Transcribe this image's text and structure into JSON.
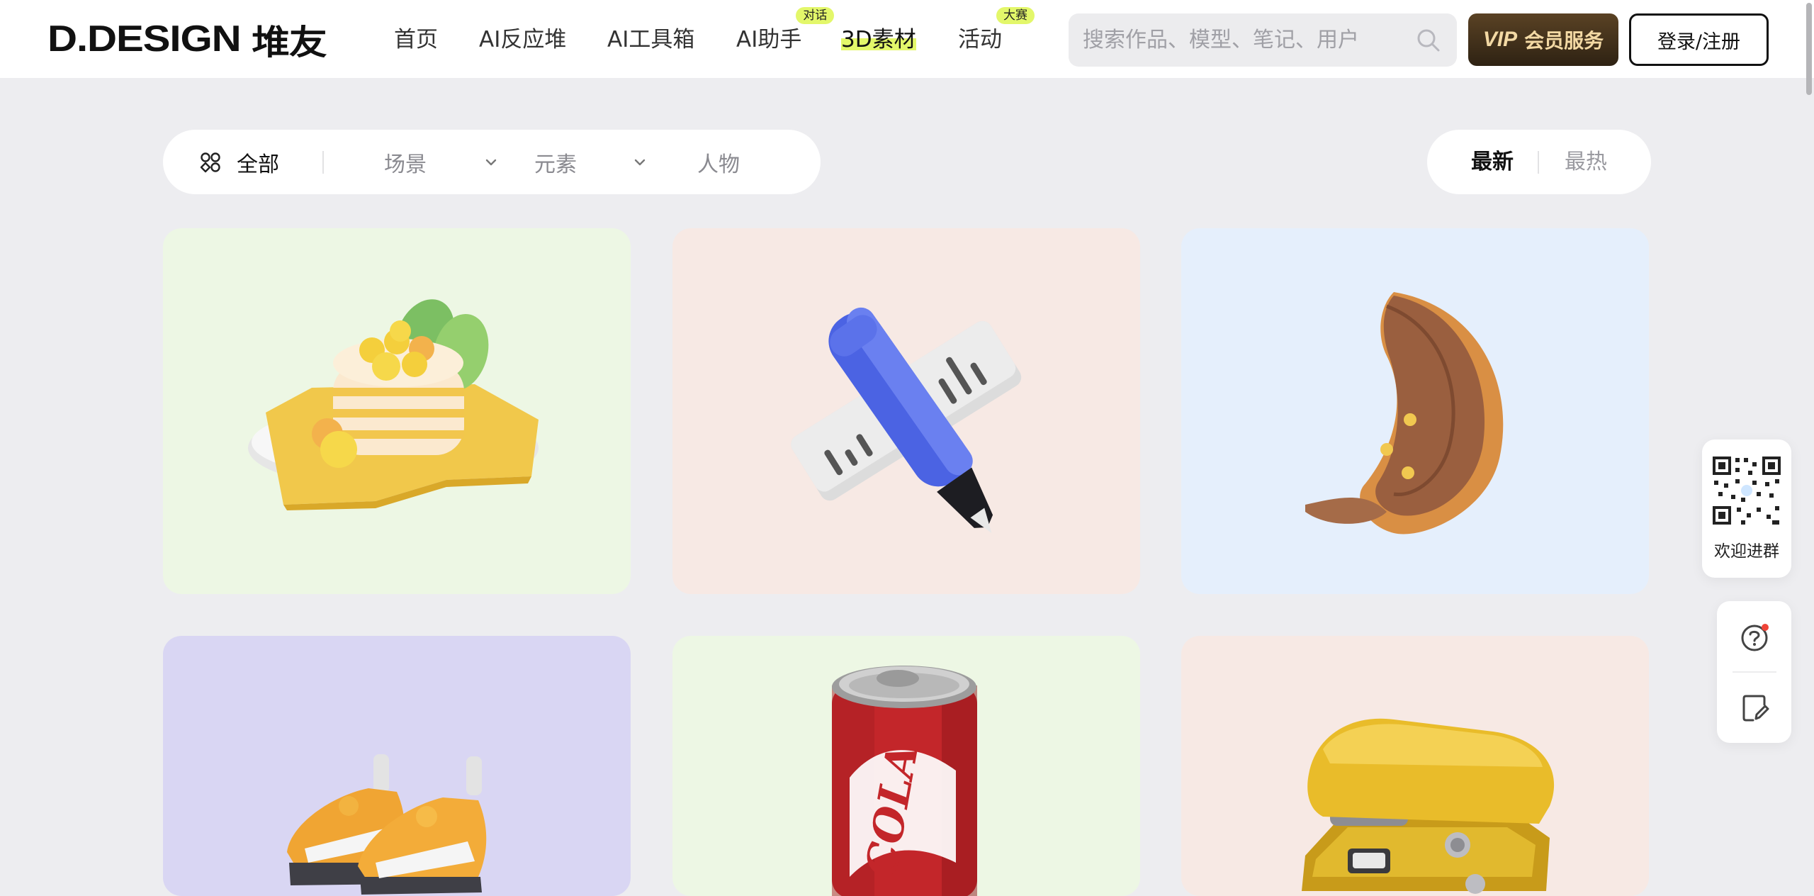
{
  "header": {
    "logo_text": "D.DESIGN",
    "logo_cn": "堆友",
    "nav": [
      {
        "label": "首页",
        "badge": ""
      },
      {
        "label": "AI反应堆",
        "badge": ""
      },
      {
        "label": "AI工具箱",
        "badge": ""
      },
      {
        "label": "AI助手",
        "badge": "对话"
      },
      {
        "label": "3D素材",
        "badge": "",
        "active": true
      },
      {
        "label": "活动",
        "badge": "大赛"
      }
    ],
    "search_placeholder": "搜索作品、模型、笔记、用户",
    "vip_mark": "VIP",
    "vip_label": "会员服务",
    "login_label": "登录/注册"
  },
  "filters": {
    "all_label": "全部",
    "items": [
      "场景",
      "元素",
      "人物"
    ]
  },
  "sort": {
    "newest": "最新",
    "hottest": "最热"
  },
  "cards": [
    {
      "name": "pancake-stack",
      "bg": "#edf7e4"
    },
    {
      "name": "pen-and-ruler",
      "bg": "#f7e9e4"
    },
    {
      "name": "croissant",
      "bg": "#e5effc"
    },
    {
      "name": "sneakers",
      "bg": "#d9d6f3"
    },
    {
      "name": "cola-can",
      "bg": "#edf7e4",
      "can_text": "COLA"
    },
    {
      "name": "stapler",
      "bg": "#f7e9e4"
    }
  ],
  "float": {
    "qr_label": "欢迎进群"
  },
  "colors": {
    "accent": "#e3f76a",
    "vip_gold": "#f3d9a4",
    "vip_bg": "#3f2e18"
  }
}
